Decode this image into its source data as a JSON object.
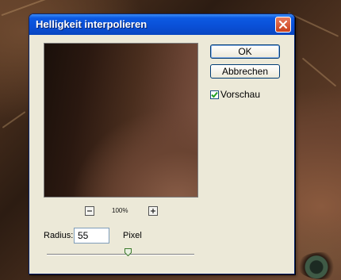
{
  "dialog": {
    "title": "Helligkeit interpolieren",
    "buttons": {
      "ok_label": "OK",
      "cancel_label": "Abbrechen"
    },
    "preview_checkbox": {
      "label": "Vorschau",
      "checked": true
    },
    "zoom": {
      "level": "100%",
      "zoom_out_icon": "minus-icon",
      "zoom_in_icon": "plus-icon"
    },
    "radius": {
      "label": "Radius:",
      "value": "55",
      "unit": "Pixel",
      "slider_fraction": 0.55
    },
    "colors": {
      "titlebar": "#0a4fd6",
      "close_button": "#c8401c",
      "dialog_background": "#ece9d8",
      "checkmark": "#21a121"
    }
  }
}
